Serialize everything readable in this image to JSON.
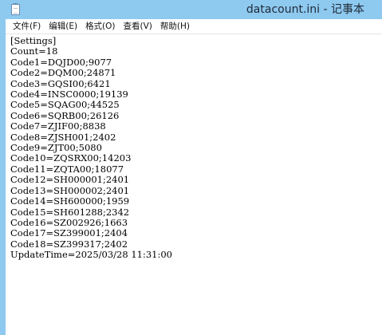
{
  "window": {
    "title": "datacount.ini - 记事本"
  },
  "menubar": {
    "items": [
      {
        "label": "文件(F)"
      },
      {
        "label": "编辑(E)"
      },
      {
        "label": "格式(O)"
      },
      {
        "label": "查看(V)"
      },
      {
        "label": "帮助(H)"
      }
    ]
  },
  "editor": {
    "content": "[Settings]\nCount=18\nCode1=DQJD00;9077\nCode2=DQM00;24871\nCode3=GQSI00;6421\nCode4=INSC0000;19139\nCode5=SQAG00;44525\nCode6=SQRB00;26126\nCode7=ZJIF00;8838\nCode8=ZJSH001;2402\nCode9=ZJT00;5080\nCode10=ZQSRX00;14203\nCode11=ZQTA00;18077\nCode12=SH000001;2401\nCode13=SH000002;2401\nCode14=SH600000;1959\nCode15=SH601288;2342\nCode16=SZ002926;1663\nCode17=SZ399001;2404\nCode18=SZ399317;2402\nUpdateTime=2025/03/28 11:31:00"
  },
  "colors": {
    "titlebar": "#8ec9f0",
    "editor_background": "#ffffff",
    "text": "#000000"
  },
  "icons": {
    "app": "notepad-icon"
  }
}
